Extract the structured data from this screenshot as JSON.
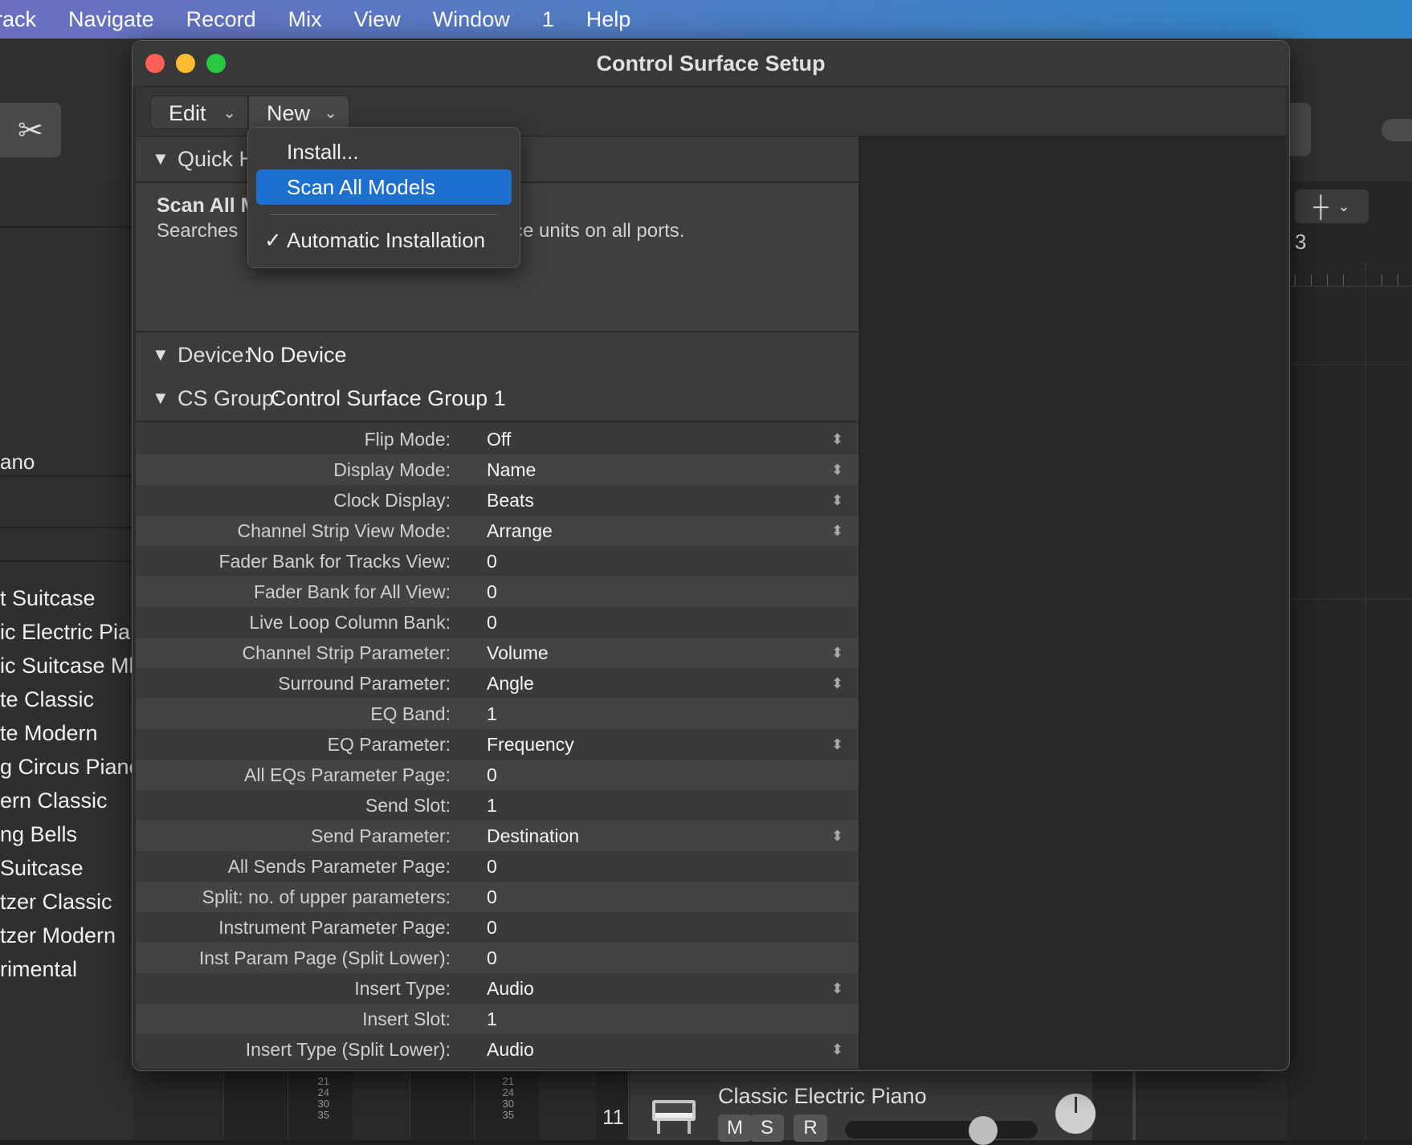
{
  "menubar": {
    "items": [
      "rack",
      "Navigate",
      "Record",
      "Mix",
      "View",
      "Window",
      "1",
      "Help"
    ]
  },
  "background": {
    "partial_piano": "ano",
    "patches": [
      "t Suitcase",
      "ic Electric Pia",
      "ic Suitcase Ml",
      "te Classic",
      "te Modern",
      "g Circus Piano",
      "ern Classic",
      "ng Bells",
      "Suitcase",
      "tzer Classic",
      "tzer Modern",
      "rimental"
    ],
    "bar_number": "3",
    "track": {
      "number": "11",
      "name": "Classic Electric Piano",
      "mute": "M",
      "solo": "S",
      "record": "R"
    },
    "meter_scale": [
      "21",
      "24",
      "30",
      "35"
    ]
  },
  "dialog": {
    "title": "Control Surface Setup",
    "toolbar": {
      "edit": "Edit",
      "new": "New"
    },
    "quick_help": {
      "header": "Quick H",
      "title": "Scan All M",
      "desc_left": "Searches",
      "desc_right": "ce units on all ports."
    },
    "device": {
      "label": "Device:",
      "value": "No Device"
    },
    "cs_group": {
      "label": "CS Group:",
      "value": "Control Surface Group 1"
    },
    "params": [
      {
        "label": "Flip Mode:",
        "value": "Off",
        "popup": true
      },
      {
        "label": "Display Mode:",
        "value": "Name",
        "popup": true
      },
      {
        "label": "Clock Display:",
        "value": "Beats",
        "popup": true
      },
      {
        "label": "Channel Strip View Mode:",
        "value": "Arrange",
        "popup": true
      },
      {
        "label": "Fader Bank for Tracks View:",
        "value": "0",
        "popup": false
      },
      {
        "label": "Fader Bank for All View:",
        "value": "0",
        "popup": false
      },
      {
        "label": "Live Loop Column Bank:",
        "value": "0",
        "popup": false
      },
      {
        "label": "Channel Strip Parameter:",
        "value": "Volume",
        "popup": true
      },
      {
        "label": "Surround Parameter:",
        "value": "Angle",
        "popup": true
      },
      {
        "label": "EQ Band:",
        "value": "1",
        "popup": false
      },
      {
        "label": "EQ Parameter:",
        "value": "Frequency",
        "popup": true
      },
      {
        "label": "All EQs Parameter Page:",
        "value": "0",
        "popup": false
      },
      {
        "label": "Send Slot:",
        "value": "1",
        "popup": false
      },
      {
        "label": "Send Parameter:",
        "value": "Destination",
        "popup": true
      },
      {
        "label": "All Sends Parameter Page:",
        "value": "0",
        "popup": false
      },
      {
        "label": "Split: no. of upper parameters:",
        "value": "0",
        "popup": false
      },
      {
        "label": "Instrument Parameter Page:",
        "value": "0",
        "popup": false
      },
      {
        "label": "Inst Param Page (Split Lower):",
        "value": "0",
        "popup": false
      },
      {
        "label": "Insert Type:",
        "value": "Audio",
        "popup": true
      },
      {
        "label": "Insert Slot:",
        "value": "1",
        "popup": false
      },
      {
        "label": "Insert Type (Split Lower):",
        "value": "Audio",
        "popup": true
      }
    ]
  },
  "new_menu": {
    "items": [
      {
        "label": "Install...",
        "checked": false,
        "highlighted": false
      },
      {
        "label": "Scan All Models",
        "checked": false,
        "highlighted": true
      },
      {
        "label": "Automatic Installation",
        "checked": true,
        "highlighted": false
      }
    ]
  },
  "colors": {
    "highlight": "#1d6fd0",
    "close": "#fe5f57",
    "minimize": "#febc2e",
    "zoom": "#28c840"
  },
  "icons": {
    "scissors": "scissors-icon",
    "chevron": "chevron-down-icon",
    "disclosure": "disclosure-triangle-icon",
    "stepper": "popup-stepper-icon",
    "check": "checkmark-icon",
    "crosshair": "crosshair-icon"
  }
}
